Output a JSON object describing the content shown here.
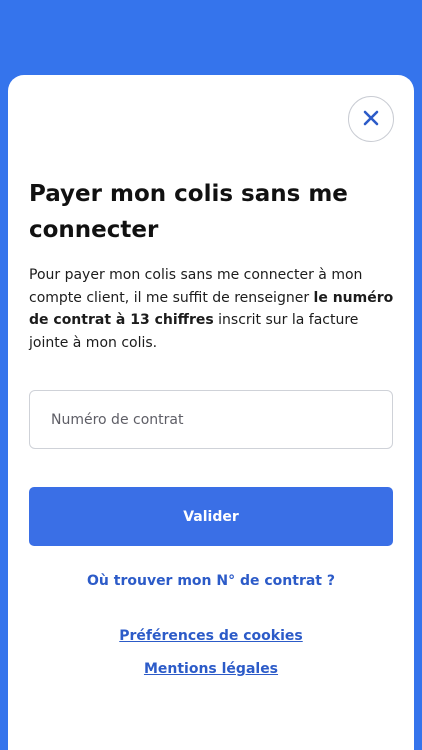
{
  "modal": {
    "title": "Payer mon colis sans me connecter",
    "description": {
      "part1": "Pour payer mon colis sans me connecter à mon compte client, il me suffit de renseigner ",
      "bold": "le numéro de contrat à 13 chiffres",
      "part2": " inscrit sur la facture jointe à mon colis."
    },
    "contract_input": {
      "placeholder": "Numéro de contrat",
      "value": ""
    },
    "validate_label": "Valider",
    "find_contract_link": "Où trouver mon N° de contrat ?",
    "cookies_link": "Préférences de cookies",
    "legal_link": "Mentions légales",
    "close_icon": "close-icon"
  },
  "colors": {
    "background": "#3574EC",
    "primary_button": "#3A6FE6",
    "link": "#2C5BC8"
  }
}
